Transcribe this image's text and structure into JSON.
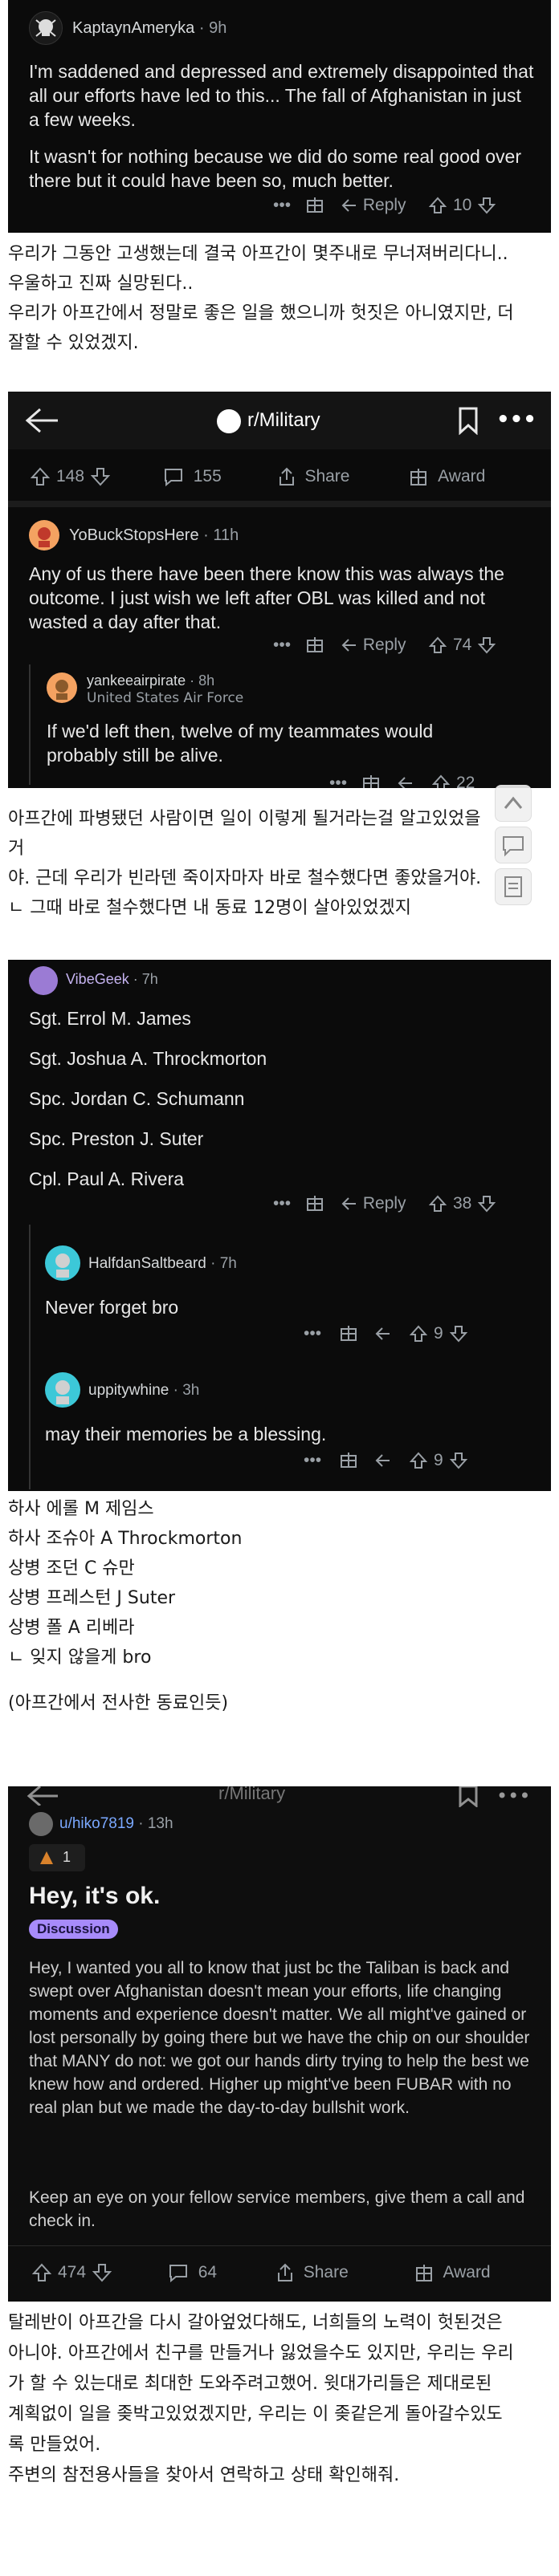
{
  "s1": {
    "username": "KaptaynAmeryka",
    "age": "9h",
    "para1": "I'm saddened and depressed and extremely disappointed that all our efforts have led to this... The fall of Afghanistan in just a few weeks.",
    "para2": "It wasn't for nothing because we did do some real good over there but it could have been so, much better.",
    "reply": "Reply",
    "votes": "10"
  },
  "ko1": {
    "line1": "우리가 그동안 고생했는데 결국 아프간이 몇주내로 무너져버리다니..",
    "line2": "우울하고 진짜 실망된다..",
    "line3": "우리가 아프간에서 정말로 좋은 일을 했으니까 헛짓은 아니였지만, 더",
    "line4": "잘할 수 있었겠지."
  },
  "s2": {
    "subreddit": "r/Military",
    "post_votes": "148",
    "comments": "155",
    "share": "Share",
    "award": "Award",
    "c1_user": "YoBuckStopsHere",
    "c1_age": "11h",
    "c1_body": "Any of us there have been there know this was always the outcome. I just wish we left after OBL was killed and not wasted a day after that.",
    "c1_reply": "Reply",
    "c1_votes": "74",
    "c2_user": "yankeeairpirate",
    "c2_age": "8h",
    "c2_flair": "United States Air Force",
    "c2_body": "If we'd left then, twelve of my teammates would probably still be alive.",
    "c2_votes": "22"
  },
  "ko2": {
    "line1": "아프간에 파병됐던 사람이면 일이 이렇게 될거라는걸 알고있었을거",
    "line2": "야. 근데 우리가 빈라덴 죽이자마자 바로 철수했다면 좋았을거야.",
    "line3": "ㄴ 그때 바로 철수했다면 내 동료 12명이 살아있었겠지"
  },
  "s3": {
    "user": "VibeGeek",
    "age": "7h",
    "names": [
      "Sgt. Errol M. James",
      "Sgt. Joshua A. Throckmorton",
      "Spc. Jordan C. Schumann",
      "Spc. Preston J. Suter",
      "Cpl. Paul A. Rivera"
    ],
    "reply": "Reply",
    "votes": "38",
    "r1_user": "HalfdanSaltbeard",
    "r1_age": "7h",
    "r1_body": "Never forget bro",
    "r1_votes": "9",
    "r2_user": "uppitywhine",
    "r2_age": "3h",
    "r2_body": "may their memories be a blessing.",
    "r2_votes": "9"
  },
  "ko3": {
    "lines": [
      "하사 에롤 M 제임스",
      "하사 조슈아 A Throckmorton",
      "상병 조던 C 슈만",
      "상병 프레스턴 J Suter",
      "상병 폴 A 리베라",
      "ㄴ 잊지 않을게 bro"
    ],
    "note": "(아프간에서 전사한 동료인듯)"
  },
  "s4": {
    "subreddit": "r/Military",
    "user": "u/hiko7819",
    "age": "13h",
    "award_count": "1",
    "title": "Hey, it's ok.",
    "flair": "Discussion",
    "para1": "Hey, I wanted you all to know that just bc the Taliban is back and swept over Afghanistan doesn't mean your efforts, life changing moments and experience doesn't matter. We all might've gained or lost personally by going there but we have the chip on our shoulder that MANY do not: we got our hands dirty trying to help the best we knew how and ordered. Higher up might've been FUBAR with no real plan but we made the day-to-day bullshit work.",
    "para2": "Keep an eye on your fellow service members, give them a call and check in.",
    "votes": "474",
    "comments": "64",
    "share": "Share",
    "award": "Award"
  },
  "ko4": {
    "lines": [
      "탈레반이 아프간을 다시 갈아엎었다해도, 너희들의 노력이 헛된것은",
      "아니야. 아프간에서 친구를 만들거나 잃었을수도 있지만, 우리는 우리",
      "가 할 수 있는대로 최대한 도와주려고했어. 윗대가리들은 제대로된",
      "계획없이 일을 좆박고있었겠지만, 우리는 이 좆같은게 돌아갈수있도",
      "록 만들었어.",
      "주변의 참전용사들을 찾아서 연락하고 상태 확인해줘."
    ]
  }
}
